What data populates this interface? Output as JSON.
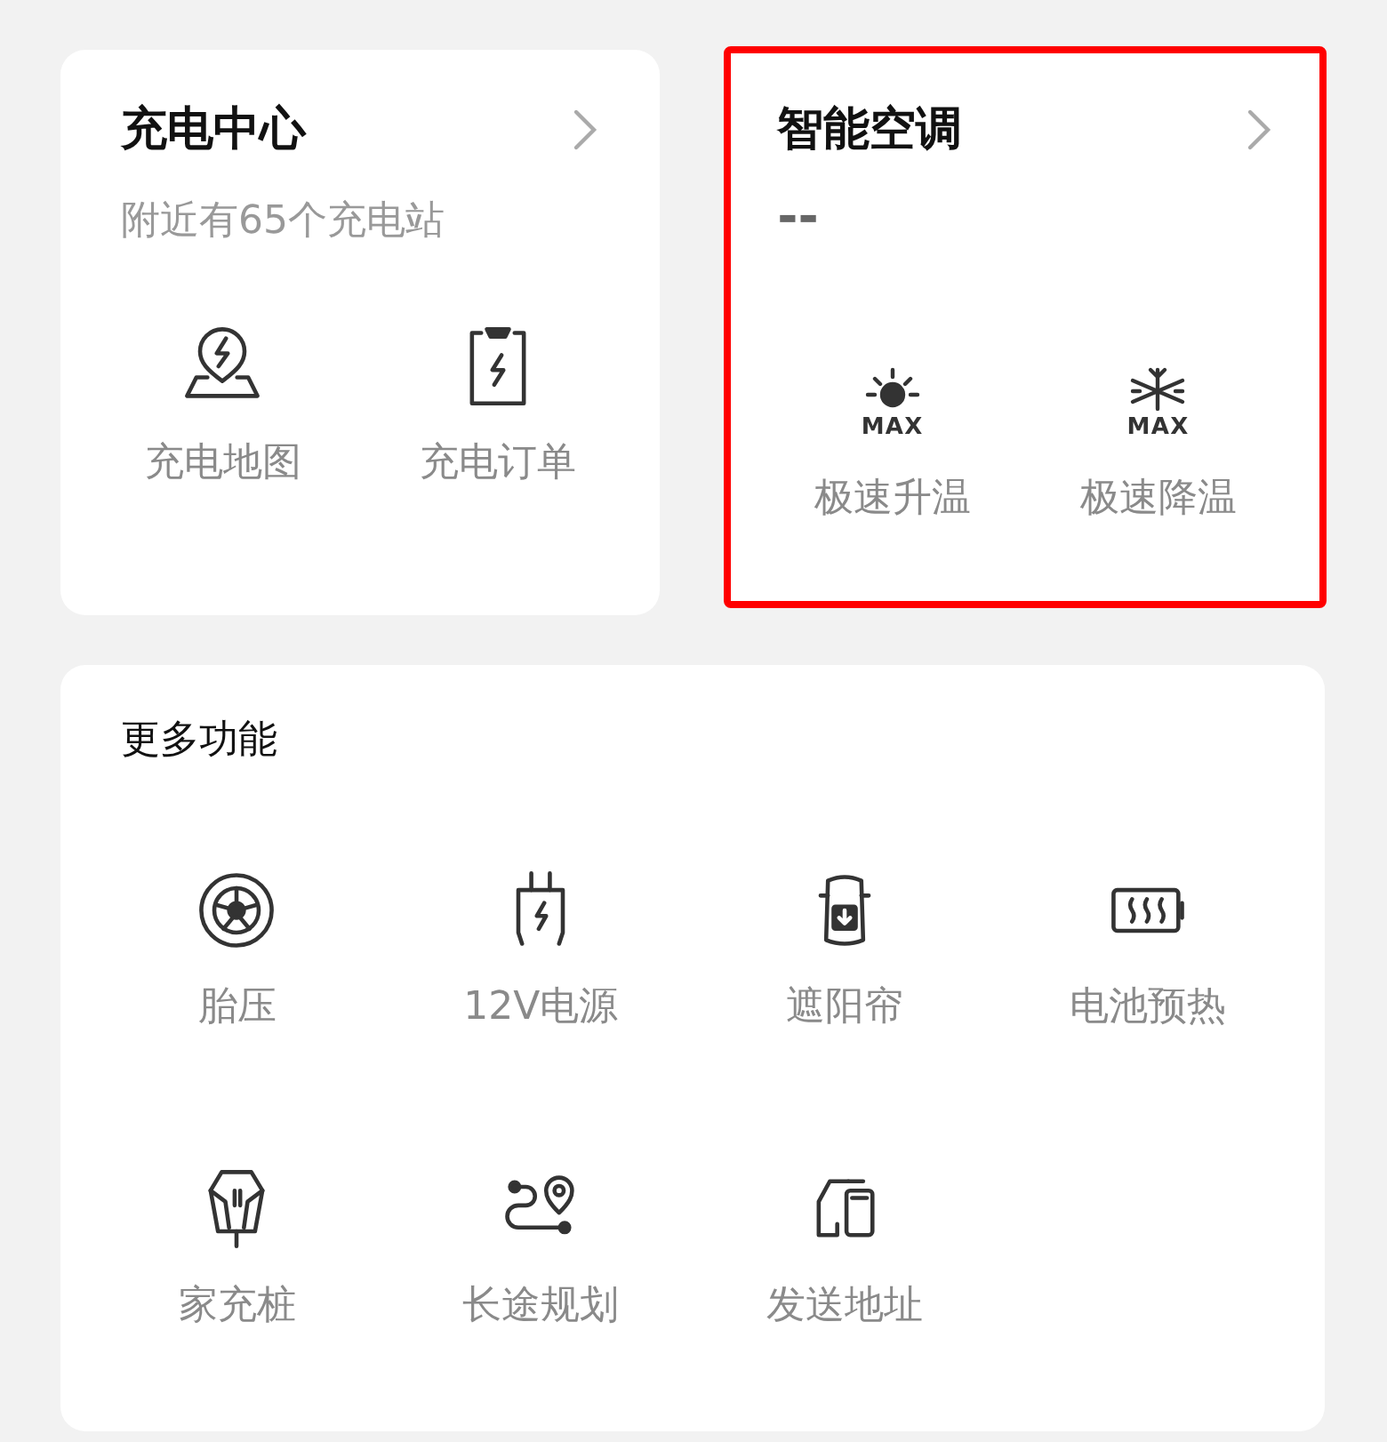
{
  "charging_center": {
    "title": "充电中心",
    "subtitle": "附近有65个充电站",
    "actions": [
      {
        "label": "充电地图"
      },
      {
        "label": "充电订单"
      }
    ]
  },
  "smart_ac": {
    "title": "智能空调",
    "status": "--",
    "highlighted": true,
    "actions": [
      {
        "badge": "MAX",
        "label": "极速升温"
      },
      {
        "badge": "MAX",
        "label": "极速降温"
      }
    ]
  },
  "more_features": {
    "title": "更多功能",
    "items": [
      {
        "label": "胎压"
      },
      {
        "label": "12V电源"
      },
      {
        "label": "遮阳帘"
      },
      {
        "label": "电池预热"
      },
      {
        "label": "家充桩"
      },
      {
        "label": "长途规划"
      },
      {
        "label": "发送地址"
      }
    ]
  }
}
